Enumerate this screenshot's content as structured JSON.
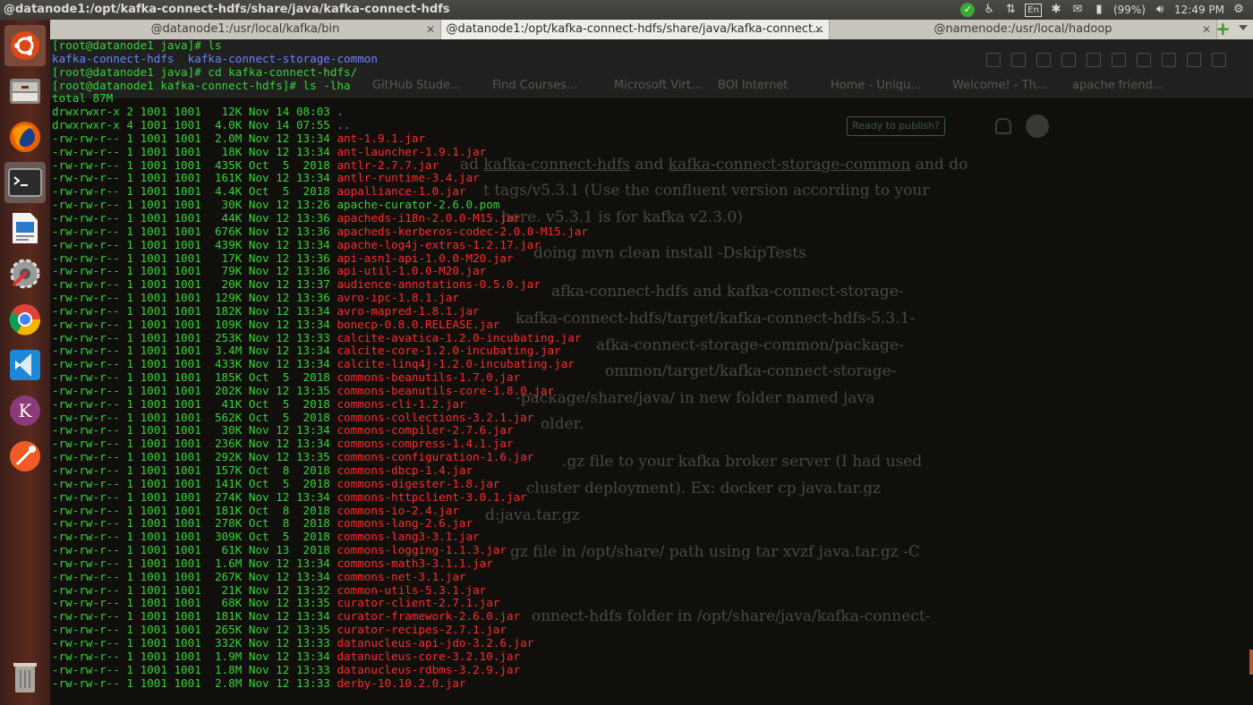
{
  "top_panel": {
    "window_title": "@datanode1:/opt/kafka-connect-hdfs/share/java/kafka-connect-hdfs",
    "keyboard_layout": "En",
    "battery": "(99%)",
    "clock": "12:49 PM"
  },
  "tabs": [
    {
      "label": "@datanode1:/usr/local/kafka/bin",
      "active": false
    },
    {
      "label": "@datanode1:/opt/kafka-connect-hdfs/share/java/kafka-connect...",
      "active": true
    },
    {
      "label": "@namenode:/usr/local/hadoop",
      "active": false
    }
  ],
  "launcher": {
    "items": [
      "ubuntu-dash-icon",
      "files-icon",
      "firefox-icon",
      "terminal-icon",
      "writer-icon",
      "system-settings-icon",
      "chrome-icon",
      "vscode-icon",
      "kate-icon",
      "postman-icon",
      "trash-icon"
    ]
  },
  "background_page": {
    "bookmarks": [
      "GitHub Stude...",
      "Find Courses...",
      "Microsoft Virt...",
      "BOI Internet",
      "Home - Uniqu...",
      "Welcome! - Th...",
      "apache friend..."
    ],
    "publish_label": "Ready to publish?",
    "lines": [
      {
        "pre": "ad ",
        "u1": "kafka-connect-hdfs",
        "mid": " and ",
        "u2": "kafka-connect-storage-common",
        "post": " and do"
      },
      {
        "text": "t tags/v5.3.1 (Use the confluent version according to your"
      },
      {
        "text": "here. v5.3.1 is for kafka v2.3.0)"
      },
      {
        "text": "doing mvn clean install -DskipTests"
      },
      {
        "text": "afka-connect-hdfs and kafka-connect-storage-"
      },
      {
        "text": "kafka-connect-hdfs/target/kafka-connect-hdfs-5.3.1-"
      },
      {
        "text": "afka-connect-storage-common/package-"
      },
      {
        "text": "ommon/target/kafka-connect-storage-"
      },
      {
        "text": "-package/share/java/ in new folder named java"
      },
      {
        "text": "older."
      },
      {
        "text": ".gz file to your kafka broker server (I had used"
      },
      {
        "text": "cluster deployment). Ex: docker cp java.tar.gz"
      },
      {
        "text": "d:java.tar.gz"
      },
      {
        "text": "gz file in /opt/share/ path using tar xvzf java.tar.gz -C"
      },
      {
        "text": "onnect-hdfs folder in /opt/share/java/kafka-connect-"
      }
    ]
  },
  "terminal": {
    "lines": [
      {
        "prompt": "[root@datanode1 java]# ",
        "cmd": "ls"
      },
      {
        "dirs": [
          "kafka-connect-hdfs",
          "kafka-connect-storage-common"
        ]
      },
      {
        "prompt": "[root@datanode1 java]# ",
        "cmd": "cd kafka-connect-hdfs/"
      },
      {
        "prompt": "[root@datanode1 kafka-connect-hdfs]# ",
        "cmd": "ls -lha"
      },
      {
        "plain": "total 87M"
      },
      {
        "meta": "drwxrwxr-x 2 1001 1001   12K Nov 14 08:03 ",
        "name": ".",
        "kind": "dir"
      },
      {
        "meta": "drwxrwxr-x 4 1001 1001  4.0K Nov 14 07:55 ",
        "name": "..",
        "kind": "dir"
      },
      {
        "meta": "-rw-rw-r-- 1 1001 1001  2.0M Nov 12 13:34 ",
        "name": "ant-1.9.1.jar",
        "kind": "jar"
      },
      {
        "meta": "-rw-rw-r-- 1 1001 1001   18K Nov 12 13:34 ",
        "name": "ant-launcher-1.9.1.jar",
        "kind": "jar"
      },
      {
        "meta": "-rw-rw-r-- 1 1001 1001  435K Oct  5  2018 ",
        "name": "antlr-2.7.7.jar",
        "kind": "jar"
      },
      {
        "meta": "-rw-rw-r-- 1 1001 1001  161K Nov 12 13:34 ",
        "name": "antlr-runtime-3.4.jar",
        "kind": "jar"
      },
      {
        "meta": "-rw-rw-r-- 1 1001 1001  4.4K Oct  5  2018 ",
        "name": "aopalliance-1.0.jar",
        "kind": "jar"
      },
      {
        "meta": "-rw-rw-r-- 1 1001 1001   30K Nov 12 13:26 ",
        "name": "apache-curator-2.6.0.pom",
        "kind": "file"
      },
      {
        "meta": "-rw-rw-r-- 1 1001 1001   44K Nov 12 13:36 ",
        "name": "apacheds-i18n-2.0.0-M15.jar",
        "kind": "jar"
      },
      {
        "meta": "-rw-rw-r-- 1 1001 1001  676K Nov 12 13:36 ",
        "name": "apacheds-kerberos-codec-2.0.0-M15.jar",
        "kind": "jar"
      },
      {
        "meta": "-rw-rw-r-- 1 1001 1001  439K Nov 12 13:34 ",
        "name": "apache-log4j-extras-1.2.17.jar",
        "kind": "jar"
      },
      {
        "meta": "-rw-rw-r-- 1 1001 1001   17K Nov 12 13:36 ",
        "name": "api-asn1-api-1.0.0-M20.jar",
        "kind": "jar"
      },
      {
        "meta": "-rw-rw-r-- 1 1001 1001   79K Nov 12 13:36 ",
        "name": "api-util-1.0.0-M20.jar",
        "kind": "jar"
      },
      {
        "meta": "-rw-rw-r-- 1 1001 1001   20K Nov 12 13:37 ",
        "name": "audience-annotations-0.5.0.jar",
        "kind": "jar"
      },
      {
        "meta": "-rw-rw-r-- 1 1001 1001  129K Nov 12 13:36 ",
        "name": "avro-ipc-1.8.1.jar",
        "kind": "jar"
      },
      {
        "meta": "-rw-rw-r-- 1 1001 1001  182K Nov 12 13:34 ",
        "name": "avro-mapred-1.8.1.jar",
        "kind": "jar"
      },
      {
        "meta": "-rw-rw-r-- 1 1001 1001  109K Nov 12 13:34 ",
        "name": "bonecp-0.8.0.RELEASE.jar",
        "kind": "jar"
      },
      {
        "meta": "-rw-rw-r-- 1 1001 1001  253K Nov 12 13:33 ",
        "name": "calcite-avatica-1.2.0-incubating.jar",
        "kind": "jar"
      },
      {
        "meta": "-rw-rw-r-- 1 1001 1001  3.4M Nov 12 13:34 ",
        "name": "calcite-core-1.2.0-incubating.jar",
        "kind": "jar"
      },
      {
        "meta": "-rw-rw-r-- 1 1001 1001  433K Nov 12 13:34 ",
        "name": "calcite-linq4j-1.2.0-incubating.jar",
        "kind": "jar"
      },
      {
        "meta": "-rw-rw-r-- 1 1001 1001  185K Oct  5  2018 ",
        "name": "commons-beanutils-1.7.0.jar",
        "kind": "jar"
      },
      {
        "meta": "-rw-rw-r-- 1 1001 1001  202K Nov 12 13:35 ",
        "name": "commons-beanutils-core-1.8.0.jar",
        "kind": "jar"
      },
      {
        "meta": "-rw-rw-r-- 1 1001 1001   41K Oct  5  2018 ",
        "name": "commons-cli-1.2.jar",
        "kind": "jar"
      },
      {
        "meta": "-rw-rw-r-- 1 1001 1001  562K Oct  5  2018 ",
        "name": "commons-collections-3.2.1.jar",
        "kind": "jar"
      },
      {
        "meta": "-rw-rw-r-- 1 1001 1001   30K Nov 12 13:34 ",
        "name": "commons-compiler-2.7.6.jar",
        "kind": "jar"
      },
      {
        "meta": "-rw-rw-r-- 1 1001 1001  236K Nov 12 13:34 ",
        "name": "commons-compress-1.4.1.jar",
        "kind": "jar"
      },
      {
        "meta": "-rw-rw-r-- 1 1001 1001  292K Nov 12 13:35 ",
        "name": "commons-configuration-1.6.jar",
        "kind": "jar"
      },
      {
        "meta": "-rw-rw-r-- 1 1001 1001  157K Oct  8  2018 ",
        "name": "commons-dbcp-1.4.jar",
        "kind": "jar"
      },
      {
        "meta": "-rw-rw-r-- 1 1001 1001  141K Oct  5  2018 ",
        "name": "commons-digester-1.8.jar",
        "kind": "jar"
      },
      {
        "meta": "-rw-rw-r-- 1 1001 1001  274K Nov 12 13:34 ",
        "name": "commons-httpclient-3.0.1.jar",
        "kind": "jar"
      },
      {
        "meta": "-rw-rw-r-- 1 1001 1001  181K Oct  8  2018 ",
        "name": "commons-io-2.4.jar",
        "kind": "jar"
      },
      {
        "meta": "-rw-rw-r-- 1 1001 1001  278K Oct  8  2018 ",
        "name": "commons-lang-2.6.jar",
        "kind": "jar"
      },
      {
        "meta": "-rw-rw-r-- 1 1001 1001  309K Oct  5  2018 ",
        "name": "commons-lang3-3.1.jar",
        "kind": "jar"
      },
      {
        "meta": "-rw-rw-r-- 1 1001 1001   61K Nov 13  2018 ",
        "name": "commons-logging-1.1.3.jar",
        "kind": "jar"
      },
      {
        "meta": "-rw-rw-r-- 1 1001 1001  1.6M Nov 12 13:34 ",
        "name": "commons-math3-3.1.1.jar",
        "kind": "jar"
      },
      {
        "meta": "-rw-rw-r-- 1 1001 1001  267K Nov 12 13:34 ",
        "name": "commons-net-3.1.jar",
        "kind": "jar"
      },
      {
        "meta": "-rw-rw-r-- 1 1001 1001   21K Nov 12 13:32 ",
        "name": "common-utils-5.3.1.jar",
        "kind": "jar"
      },
      {
        "meta": "-rw-rw-r-- 1 1001 1001   68K Nov 12 13:35 ",
        "name": "curator-client-2.7.1.jar",
        "kind": "jar"
      },
      {
        "meta": "-rw-rw-r-- 1 1001 1001  181K Nov 12 13:34 ",
        "name": "curator-framework-2.6.0.jar",
        "kind": "jar"
      },
      {
        "meta": "-rw-rw-r-- 1 1001 1001  265K Nov 12 13:35 ",
        "name": "curator-recipes-2.7.1.jar",
        "kind": "jar"
      },
      {
        "meta": "-rw-rw-r-- 1 1001 1001  332K Nov 12 13:33 ",
        "name": "datanucleus-api-jdo-3.2.6.jar",
        "kind": "jar"
      },
      {
        "meta": "-rw-rw-r-- 1 1001 1001  1.9M Nov 12 13:34 ",
        "name": "datanucleus-core-3.2.10.jar",
        "kind": "jar"
      },
      {
        "meta": "-rw-rw-r-- 1 1001 1001  1.8M Nov 12 13:33 ",
        "name": "datanucleus-rdbms-3.2.9.jar",
        "kind": "jar"
      },
      {
        "meta": "-rw-rw-r-- 1 1001 1001  2.8M Nov 12 13:33 ",
        "name": "derby-10.10.2.0.jar",
        "kind": "jar"
      }
    ]
  },
  "colors": {
    "prompt": "#38d338",
    "dir": "#6a84ff",
    "jar": "#ff2b2b",
    "plain": "#ffffff"
  }
}
